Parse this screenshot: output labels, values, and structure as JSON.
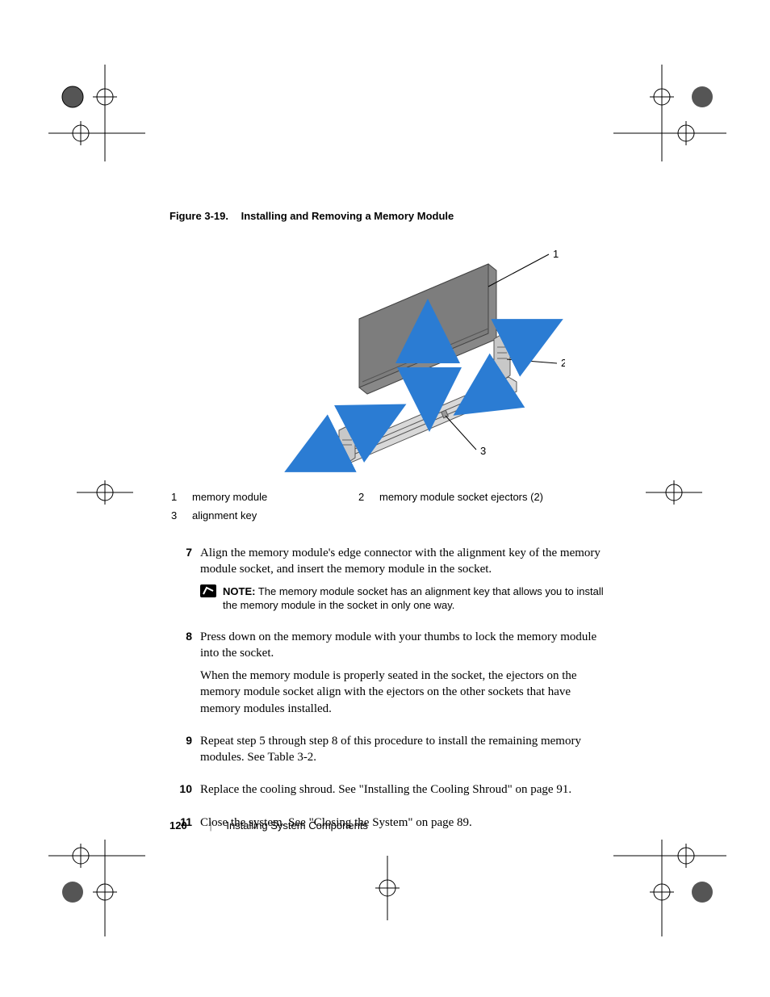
{
  "figure": {
    "label_prefix": "Figure 3-19.",
    "title": "Installing and Removing a Memory Module",
    "callouts": {
      "one": "1",
      "two": "2",
      "three": "3"
    }
  },
  "legend": {
    "rows": [
      {
        "n": "1",
        "t": "memory module"
      },
      {
        "n": "2",
        "t": "memory module socket ejectors (2)"
      },
      {
        "n": "3",
        "t": "alignment key"
      }
    ]
  },
  "steps": [
    {
      "n": "7",
      "paras": [
        "Align the memory module's edge connector with the alignment key of the memory module socket, and insert the memory module in the socket."
      ],
      "note": {
        "label": "NOTE:",
        "text": " The memory module socket has an alignment key that allows you to install the memory module in the socket in only one way."
      }
    },
    {
      "n": "8",
      "paras": [
        "Press down on the memory module with your thumbs to lock the memory module into the socket.",
        "When the memory module is properly seated in the socket, the ejectors on the memory module socket align with the ejectors on the other sockets that have memory modules installed."
      ]
    },
    {
      "n": "9",
      "paras": [
        "Repeat step 5 through step 8 of this procedure to install the remaining memory modules. See Table 3-2."
      ]
    },
    {
      "n": "10",
      "paras": [
        "Replace the cooling shroud. See \"Installing the Cooling Shroud\" on page 91."
      ]
    },
    {
      "n": "11",
      "paras": [
        "Close the system. See \"Closing the System\" on page 89."
      ]
    }
  ],
  "footer": {
    "page": "120",
    "section": "Installing System Components"
  }
}
